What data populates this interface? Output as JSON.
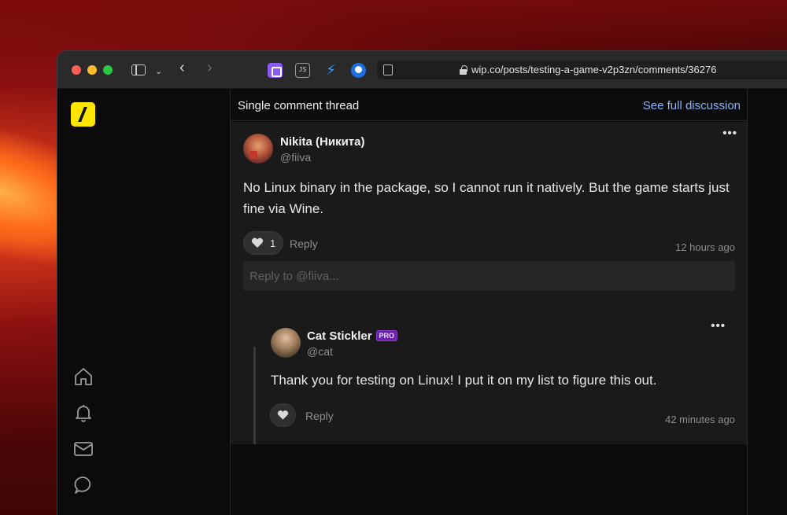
{
  "browser": {
    "url": "wip.co/posts/testing-a-game-v2p3zn/comments/36276",
    "extensions": [
      "extension-purple-icon",
      "js-extension-icon",
      "bolt-extension-icon",
      "globe-extension-icon"
    ]
  },
  "header": {
    "title": "Single comment thread",
    "link": "See full discussion"
  },
  "comments": [
    {
      "author": "Nikita (Никита)",
      "handle": "@fiiva",
      "body": "No Linux binary in the package, so I cannot run it natively. But the game starts just fine via Wine.",
      "likes": "1",
      "reply_label": "Reply",
      "time": "12 hours ago",
      "reply_placeholder": "Reply to @fiiva..."
    },
    {
      "author": "Cat Stickler",
      "badge": "PRO",
      "handle": "@cat",
      "body": "Thank you for testing on Linux! I put it on my list to figure this out.",
      "reply_label": "Reply",
      "time": "42 minutes ago"
    }
  ],
  "colors": {
    "accent_logo": "#ffe600",
    "link": "#8ab4f8",
    "pro_badge": "#6b21a8"
  }
}
